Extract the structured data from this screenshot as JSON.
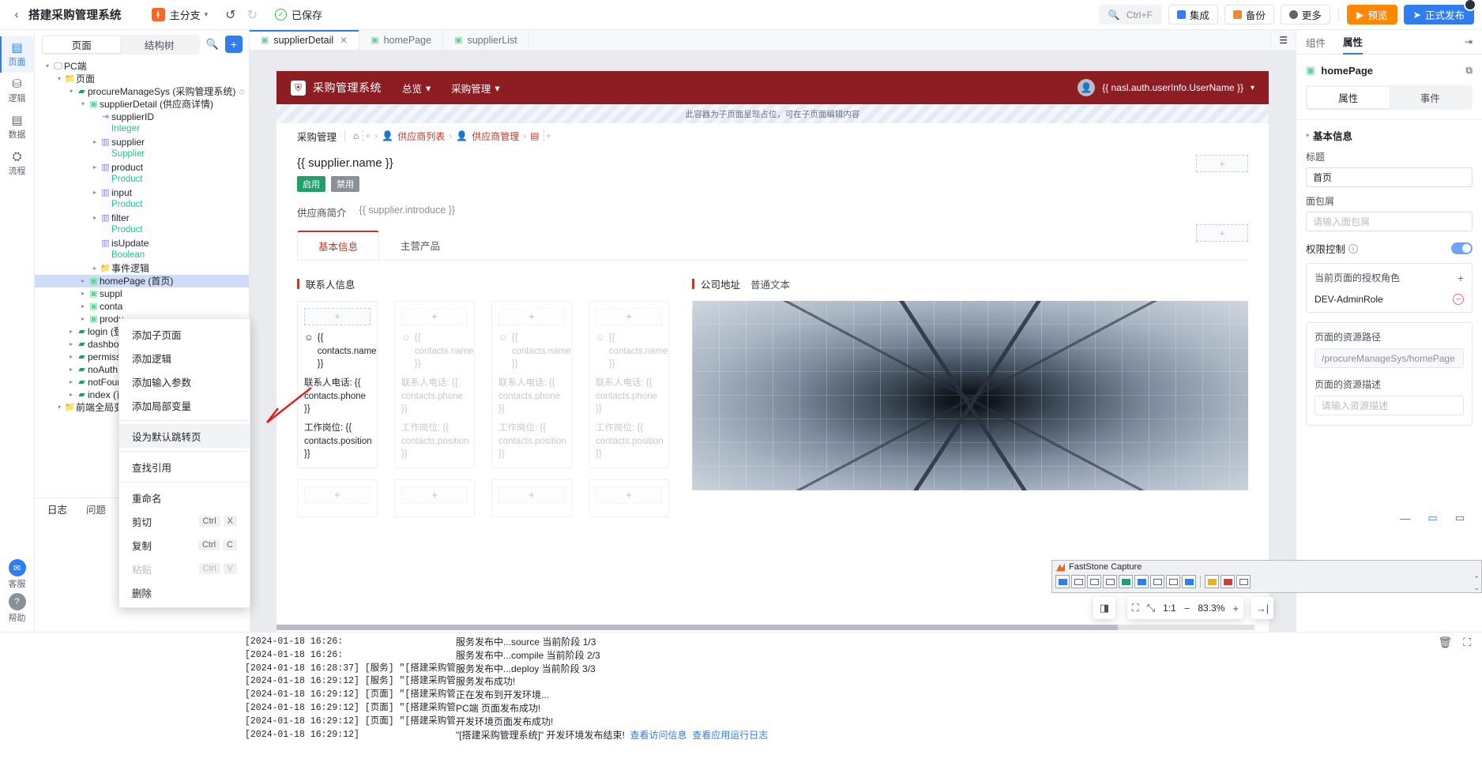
{
  "topbar": {
    "back": "‹",
    "project_title": "搭建采购管理系统",
    "branch_icon_text": "ᚼ",
    "branch_name": "主分支",
    "undo": "↺",
    "redo": "↻",
    "saved_text": "已保存",
    "search_shortcut": "Ctrl+F",
    "integrate": "集成",
    "backup": "备份",
    "more": "更多",
    "preview": "预览",
    "publish": "正式发布"
  },
  "rail": {
    "items": [
      {
        "label": "页面",
        "icon": "▤"
      },
      {
        "label": "逻辑",
        "icon": "⛁"
      },
      {
        "label": "数据",
        "icon": "▤"
      },
      {
        "label": "流程",
        "icon": "⛭"
      }
    ],
    "bottom": [
      {
        "label": "客服",
        "icon": "✉"
      },
      {
        "label": "帮助",
        "icon": "?"
      }
    ]
  },
  "tree": {
    "tabs": [
      "页面",
      "结构树"
    ],
    "active_tab": "页面",
    "search_icon": "search-icon",
    "add_icon": "+",
    "nodes": [
      {
        "depth": 0,
        "twisty": "▾",
        "icon": "🖵",
        "icon_class": "ic-mon",
        "label": "PC端"
      },
      {
        "depth": 1,
        "twisty": "▾",
        "icon": "📁",
        "icon_class": "ic-fold",
        "label": "页面"
      },
      {
        "depth": 2,
        "twisty": "▾",
        "icon": "▰",
        "icon_class": "ic-mod",
        "label": "procureManageSys (采购管理系统)",
        "home": "⌂"
      },
      {
        "depth": 3,
        "twisty": "▾",
        "icon": "▣",
        "icon_class": "ic-page",
        "label": "supplierDetail (供应商详情)"
      },
      {
        "depth": 4,
        "twisty": "",
        "icon": "⇥",
        "icon_class": "ic-param",
        "label": "supplierID",
        "sub": "Integer"
      },
      {
        "depth": 4,
        "twisty": "▸",
        "icon": "▥",
        "icon_class": "ic-var",
        "label": "supplier",
        "sub": "Supplier"
      },
      {
        "depth": 4,
        "twisty": "▸",
        "icon": "▥",
        "icon_class": "ic-var",
        "label": "product",
        "sub": "Product"
      },
      {
        "depth": 4,
        "twisty": "▸",
        "icon": "▥",
        "icon_class": "ic-var",
        "label": "input",
        "sub": "Product"
      },
      {
        "depth": 4,
        "twisty": "▸",
        "icon": "▥",
        "icon_class": "ic-var",
        "label": "filter",
        "sub": "Product"
      },
      {
        "depth": 4,
        "twisty": "",
        "icon": "▥",
        "icon_class": "ic-var",
        "label": "isUpdate",
        "sub": "Boolean"
      },
      {
        "depth": 4,
        "twisty": "▸",
        "icon": "📁",
        "icon_class": "ic-fold",
        "label": "事件逻辑"
      },
      {
        "depth": 3,
        "twisty": "▸",
        "icon": "▣",
        "icon_class": "ic-page",
        "label": "homePage (首页)",
        "selected": true
      },
      {
        "depth": 3,
        "twisty": "▸",
        "icon": "▣",
        "icon_class": "ic-page",
        "label": "suppl"
      },
      {
        "depth": 3,
        "twisty": "▸",
        "icon": "▣",
        "icon_class": "ic-page",
        "label": "conta"
      },
      {
        "depth": 3,
        "twisty": "▸",
        "icon": "▣",
        "icon_class": "ic-page",
        "label": "produ"
      },
      {
        "depth": 2,
        "twisty": "▸",
        "icon": "▰",
        "icon_class": "ic-mod",
        "label": "login (登"
      },
      {
        "depth": 2,
        "twisty": "▸",
        "icon": "▰",
        "icon_class": "ic-mod",
        "label": "dashboa"
      },
      {
        "depth": 2,
        "twisty": "▸",
        "icon": "▰",
        "icon_class": "ic-mod",
        "label": "permissi"
      },
      {
        "depth": 2,
        "twisty": "▸",
        "icon": "▰",
        "icon_class": "ic-mod",
        "label": "noAuth"
      },
      {
        "depth": 2,
        "twisty": "▸",
        "icon": "▰",
        "icon_class": "ic-mod",
        "label": "notFoun"
      },
      {
        "depth": 2,
        "twisty": "▸",
        "icon": "▰",
        "icon_class": "ic-mod",
        "label": "index (首"
      },
      {
        "depth": 1,
        "twisty": "▾",
        "icon": "📁",
        "icon_class": "ic-fold",
        "label": "前端全局变"
      }
    ]
  },
  "context_menu": {
    "items": [
      {
        "label": "添加子页面"
      },
      {
        "label": "添加逻辑"
      },
      {
        "label": "添加输入参数"
      },
      {
        "label": "添加局部变量"
      },
      {
        "sep": true
      },
      {
        "label": "设为默认跳转页",
        "highlight": true
      },
      {
        "sep": true
      },
      {
        "label": "查找引用"
      },
      {
        "sep": true
      },
      {
        "label": "重命名"
      },
      {
        "label": "剪切",
        "shortcut": [
          "Ctrl",
          "X"
        ]
      },
      {
        "label": "复制",
        "shortcut": [
          "Ctrl",
          "C"
        ]
      },
      {
        "label": "粘贴",
        "shortcut": [
          "Ctrl",
          "V"
        ],
        "disabled": true
      },
      {
        "label": "删除"
      }
    ]
  },
  "editor_tabs": {
    "tabs": [
      {
        "label": "supplierDetail",
        "active": true,
        "closable": true
      },
      {
        "label": "homePage",
        "active": false
      },
      {
        "label": "supplierList",
        "active": false
      }
    ],
    "list_icon": "☰"
  },
  "canvas": {
    "appnav": {
      "logo": "⛨",
      "brand": "采购管理系统",
      "menus": [
        "总览",
        "采购管理"
      ],
      "user_expr": "{{ nasl.auth.userInfo.UserName }}"
    },
    "slot_hint": "此容器为子页面呈现占位，可在子页面编辑内容",
    "breadcrumb": {
      "title": "采购管理",
      "home_icon": "⌂",
      "items": [
        "供应商列表",
        "供应商管理"
      ],
      "trailing_icon": "▤"
    },
    "detail": {
      "name_expr": "{{ supplier.name }}",
      "badge_enabled": "启用",
      "badge_disabled": "禁用",
      "intro_label": "供应商简介",
      "intro_expr": "{{ supplier.introduce }}",
      "tabs": [
        "基本信息",
        "主营产品"
      ],
      "active_tab": "基本信息",
      "section_title": "联系人信息",
      "contact_cards": [
        {
          "name_expr": "{{ contacts.name }}",
          "phone_label": "联系人电话:",
          "phone_expr": "{{ contacts.phone }}",
          "position_label": "工作岗位:",
          "position_expr": "{{ contacts.position }}",
          "ghost": false
        },
        {
          "name_expr": "{{ contacts.name }}",
          "phone_label": "联系人电话:",
          "phone_expr": "{{ contacts.phone }}",
          "position_label": "工作岗位:",
          "position_expr": "{{ contacts.position }}",
          "ghost": true
        },
        {
          "name_expr": "{{ contacts.name }}",
          "phone_label": "联系人电话:",
          "phone_expr": "{{ contacts.phone }}",
          "position_label": "工作岗位:",
          "position_expr": "{{ contacts.position }}",
          "ghost": true
        },
        {
          "name_expr": "{{ contacts.name }}",
          "phone_label": "联系人电话:",
          "phone_expr": "{{ contacts.phone }}",
          "position_label": "工作岗位:",
          "position_expr": "{{ contacts.position }}",
          "ghost": true
        }
      ],
      "address_label": "公司地址",
      "address_type": "普通文本"
    },
    "zoom": {
      "fit_icon": "⛶",
      "collapse_icon": "⤡",
      "ratio": "1:1",
      "minus": "−",
      "value": "83.3%",
      "plus": "+",
      "panel_left_icon": "◨",
      "panel_right_icon": "→|"
    }
  },
  "right_panel": {
    "tabs": [
      "组件",
      "属性"
    ],
    "active_tab": "属性",
    "collapse_icon": "⇥",
    "page_name": "homePage",
    "copy_icon": "⧉",
    "sub_tabs": [
      "属性",
      "事件"
    ],
    "active_sub_tab": "属性",
    "group_basic": "基本信息",
    "title_label": "标题",
    "title_value": "首页",
    "breadcrumb_label": "面包屑",
    "breadcrumb_placeholder": "请输入面包屑",
    "permission_label": "权限控制",
    "roles_header": "当前页面的授权角色",
    "roles": [
      "DEV-AdminRole"
    ],
    "path_label": "页面的资源路径",
    "path_value": "/procureManageSys/homePage",
    "desc_label": "页面的资源描述",
    "desc_placeholder": "请输入资源描述"
  },
  "console": {
    "tabs": [
      "日志",
      "问题"
    ],
    "active_tab": "日志",
    "clear_icon": "🗑",
    "expand_icon": "⛶",
    "lines": [
      {
        "ts": "[2024-01-18 16:26:",
        "msg": "服务发布中...source  当前阶段  1/3"
      },
      {
        "ts": "[2024-01-18 16:26:",
        "msg": "服务发布中...compile  当前阶段  2/3"
      },
      {
        "ts": "[2024-01-18 16:28:37] [服务] \"[搭建采购管理系统]\"",
        "msg": "服务发布中...deploy  当前阶段  3/3"
      },
      {
        "ts": "[2024-01-18 16:29:12] [服务] \"[搭建采购管理系统]\"",
        "msg": "服务发布成功!"
      },
      {
        "ts": "[2024-01-18 16:29:12] [页面] \"[搭建采购管理系统]\"",
        "msg": "正在发布到开发环境..."
      },
      {
        "ts": "[2024-01-18 16:29:12] [页面] \"[搭建采购管理系统]\"",
        "msg": "PC端 页面发布成功!"
      },
      {
        "ts": "[2024-01-18 16:29:12] [页面] \"[搭建采购管理系统]\"",
        "msg": "开发环境页面发布成功!"
      },
      {
        "ts": "[2024-01-18 16:29:12]",
        "msg": "\"[搭建采购管理系统]\" 开发环境发布结束!",
        "links": [
          "查看访问信息",
          "查看应用运行日志"
        ]
      }
    ]
  },
  "window_controls": {
    "minimize": "—",
    "restore": "▭",
    "close": "▭"
  },
  "faststone": {
    "title": "FastStone Capture",
    "side_arrows": [
      "⌃",
      "⌄"
    ]
  },
  "colors": {
    "accent_blue": "#2e7ef0",
    "brand_red": "#8c1d22",
    "preview_orange": "#ff8800",
    "success_green": "#22a06b"
  }
}
